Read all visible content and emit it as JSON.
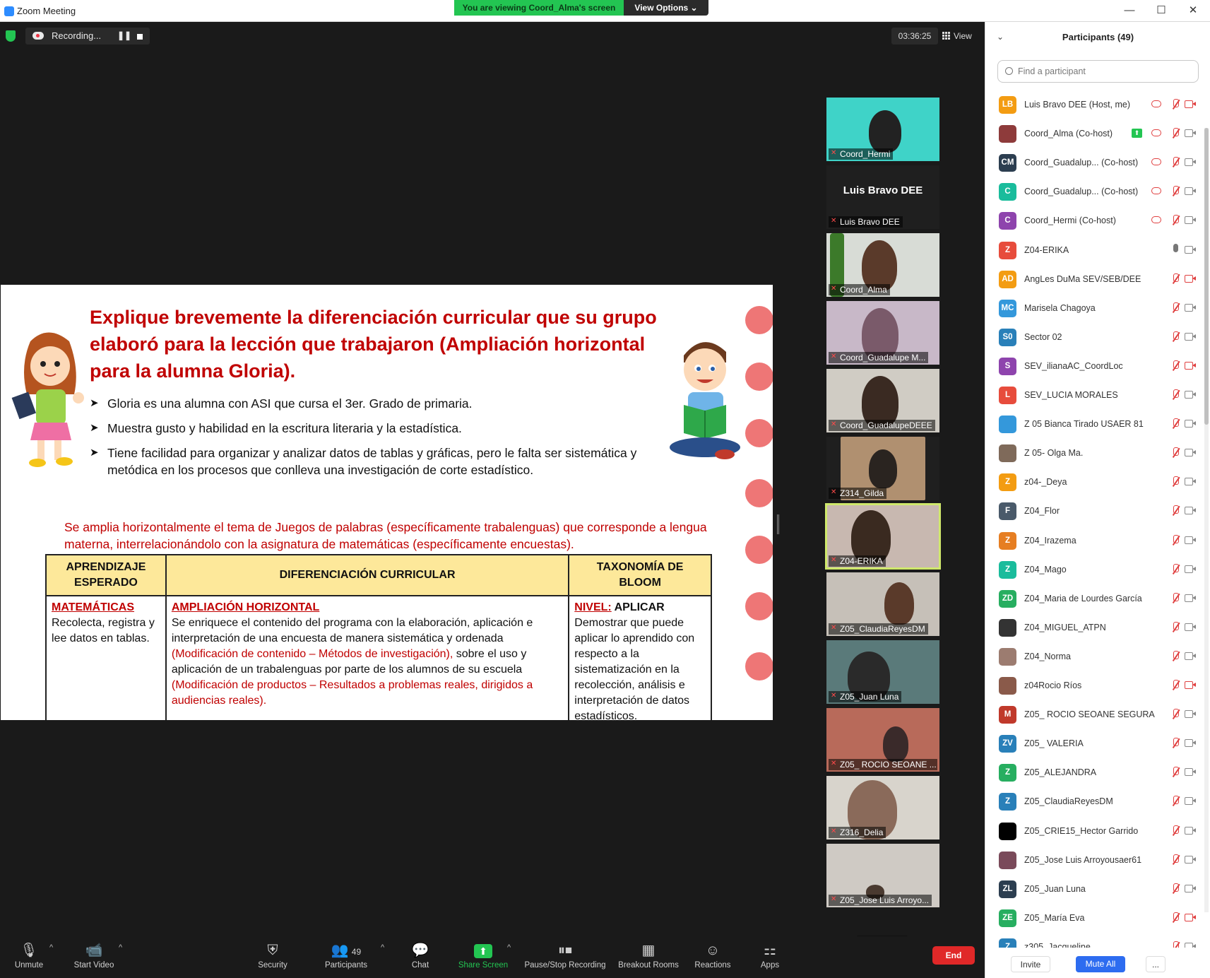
{
  "window": {
    "title": "Zoom Meeting"
  },
  "banner": {
    "viewing": "You are viewing Coord_Alma's screen",
    "view_options": "View Options ⌄"
  },
  "window_controls": {
    "minimize": "—",
    "maximize": "☐",
    "close": "✕"
  },
  "meeting": {
    "recording_label": "Recording...",
    "pause_glyph": "❚❚",
    "timer": "03:36:25",
    "view_label": "View"
  },
  "slide": {
    "title": "Explique brevemente la diferenciación curricular que su grupo elaboró para la lección que trabajaron (Ampliación horizontal para la alumna Gloria).",
    "bullets": [
      "Gloria es una alumna con ASI que cursa el 3er. Grado de primaria.",
      "Muestra gusto y habilidad en la escritura literaria y la estadística.",
      "Tiene facilidad para organizar y analizar datos de tablas y gráficas, pero le falta ser sistemática y metódica en los procesos que conlleva una investigación de corte estadístico."
    ],
    "paragraph": "Se amplia horizontalmente el tema de Juegos de palabras (específicamente trabalenguas) que corresponde a lengua materna, interrelacionándolo con la asignatura de matemáticas (específicamente encuestas).",
    "table": {
      "headers": [
        "APRENDIZAJE ESPERADO",
        "DIFERENCIACIÓN CURRICULAR",
        "TAXONOMÍA DE BLOOM"
      ],
      "col1_heading": "MATEMÁTICAS",
      "col1_text": "Recolecta, registra y lee datos en tablas.",
      "col2_heading": "AMPLIACIÓN HORIZONTAL",
      "col2_text_a": "Se enriquece el contenido del programa con la elaboración, aplicación e interpretación de una encuesta de manera sistemática y ordenada ",
      "col2_red_a": "(Modificación de contenido – Métodos de investigación),",
      "col2_text_b": " sobre el uso y aplicación de un trabalenguas por parte de los alumnos de su escuela ",
      "col2_red_b": "(Modificación de productos – Resultados a problemas reales, dirigidos a audiencias reales).",
      "col3_heading": "NIVEL:",
      "col3_level": " APLICAR",
      "col3_text": "Demostrar que puede aplicar lo aprendido con respecto a la sistematización en la recolección, análisis e interpretación de datos estadísticos."
    }
  },
  "video_tiles": [
    {
      "name": "Coord_Hermi"
    },
    {
      "name": "Luis Bravo DEE",
      "big_name": "Luis Bravo DEE"
    },
    {
      "name": "Coord_Alma"
    },
    {
      "name": "Coord_Guadalupe M..."
    },
    {
      "name": "Coord_GuadalupeDEEE"
    },
    {
      "name": "Z314_Gilda"
    },
    {
      "name": "Z04-ERIKA"
    },
    {
      "name": "Z05_ClaudiaReyesDM"
    },
    {
      "name": "Z05_Juan Luna"
    },
    {
      "name": "Z05_ ROCIO SEOANE ..."
    },
    {
      "name": "Z316_Delia"
    },
    {
      "name": "Z05_Jose Luis Arroyo..."
    }
  ],
  "strip_down_glyph": "⌄",
  "toolbar": {
    "unmute": "Unmute",
    "start_video": "Start Video",
    "security": "Security",
    "participants": "Participants",
    "participants_count": "49",
    "chat": "Chat",
    "share_screen": "Share Screen",
    "pause_stop_recording": "Pause/Stop Recording",
    "breakout_rooms": "Breakout Rooms",
    "reactions": "Reactions",
    "apps": "Apps",
    "end": "End",
    "caret": "^"
  },
  "panel": {
    "title": "Participants (49)",
    "collapse_glyph": "⌄",
    "search_placeholder": "Find a participant",
    "participants": [
      {
        "initials": "LB",
        "color": "#f39c12",
        "name": "Luis Bravo DEE (Host, me)",
        "video_off": true
      },
      {
        "initials": "",
        "color": "#8e3b3b",
        "name": "Coord_Alma (Co-host)",
        "video_off": false,
        "sharing": true
      },
      {
        "initials": "CM",
        "color": "#2c3e50",
        "name": "Coord_Guadalup...  (Co-host)",
        "video_off": false
      },
      {
        "initials": "C",
        "color": "#1abc9c",
        "name": "Coord_Guadalup...  (Co-host)",
        "video_off": false
      },
      {
        "initials": "C",
        "color": "#8e44ad",
        "name": "Coord_Hermi (Co-host)",
        "video_off": false
      },
      {
        "initials": "Z",
        "color": "#e74c3c",
        "name": "Z04-ERIKA",
        "video_off": false,
        "unmuted": true
      },
      {
        "initials": "AD",
        "color": "#f39c12",
        "name": "AngLes DuMa SEV/SEB/DEE",
        "video_off": true
      },
      {
        "initials": "MC",
        "color": "#3498db",
        "name": "Marisela Chagoya",
        "video_off": false
      },
      {
        "initials": "S0",
        "color": "#2980b9",
        "name": "Sector 02",
        "video_off": false
      },
      {
        "initials": "S",
        "color": "#8e44ad",
        "name": "SEV_ilianaAC_CoordLoc",
        "video_off": true
      },
      {
        "initials": "L",
        "color": "#e74c3c",
        "name": "SEV_LUCIA MORALES",
        "video_off": false
      },
      {
        "initials": "",
        "color": "#3498db",
        "name": "Z 05 Bianca Tirado USAER 81",
        "video_off": false
      },
      {
        "initials": "",
        "color": "#7f6a5a",
        "name": "Z 05- Olga Ma.",
        "video_off": false
      },
      {
        "initials": "Z",
        "color": "#f39c12",
        "name": "z04-_Deya",
        "video_off": false
      },
      {
        "initials": "F",
        "color": "#4a5a6a",
        "name": "Z04_Flor",
        "video_off": false
      },
      {
        "initials": "Z",
        "color": "#e67e22",
        "name": "Z04_Irazema",
        "video_off": false
      },
      {
        "initials": "Z",
        "color": "#1abc9c",
        "name": "Z04_Mago",
        "video_off": false
      },
      {
        "initials": "ZD",
        "color": "#27ae60",
        "name": "Z04_Maria de Lourdes García",
        "video_off": false
      },
      {
        "initials": "",
        "color": "#333333",
        "name": "Z04_MIGUEL_ATPN",
        "video_off": false
      },
      {
        "initials": "",
        "color": "#9c7c70",
        "name": "Z04_Norma",
        "video_off": false
      },
      {
        "initials": "",
        "color": "#8a5a4a",
        "name": "z04Rocio Ríos",
        "video_off": true
      },
      {
        "initials": "M",
        "color": "#c0392b",
        "name": "Z05_ ROCIO SEOANE SEGURA",
        "video_off": false
      },
      {
        "initials": "ZV",
        "color": "#2980b9",
        "name": "Z05_ VALERIA",
        "video_off": false
      },
      {
        "initials": "Z",
        "color": "#27ae60",
        "name": "Z05_ALEJANDRA",
        "video_off": false
      },
      {
        "initials": "Z",
        "color": "#2980b9",
        "name": "Z05_ClaudiaReyesDM",
        "video_off": false
      },
      {
        "initials": "",
        "color": "#000000",
        "name": "Z05_CRIE15_Hector Garrido",
        "video_off": false
      },
      {
        "initials": "",
        "color": "#7a4a5a",
        "name": "Z05_Jose Luis Arroyousaer61",
        "video_off": false
      },
      {
        "initials": "ZL",
        "color": "#2c3e50",
        "name": "Z05_Juan Luna",
        "video_off": false
      },
      {
        "initials": "ZE",
        "color": "#27ae60",
        "name": "Z05_María Eva",
        "video_off": true
      },
      {
        "initials": "Z",
        "color": "#2980b9",
        "name": "z305_Jacqueline",
        "video_off": false
      }
    ],
    "invite": "Invite",
    "mute_all": "Mute All",
    "more": "..."
  }
}
